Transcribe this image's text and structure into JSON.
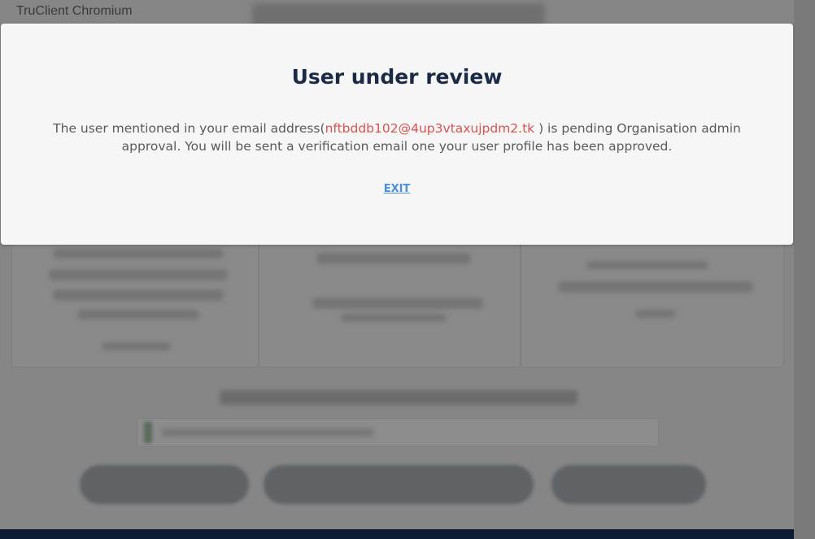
{
  "window": {
    "title": "TruClient Chromium"
  },
  "modal": {
    "title": "User under review",
    "message_prefix": "The user mentioned in your email address(",
    "email": "nftbddb102@4up3vtaxujpdm2.tk",
    "message_suffix": " ) is pending Organisation admin approval. You will be sent a verification email one your user profile has been approved.",
    "exit_label": "EXIT"
  },
  "colors": {
    "title": "#1b2a47",
    "email": "#d9534f",
    "link": "#4a90d9",
    "footer": "#0c1a33"
  }
}
